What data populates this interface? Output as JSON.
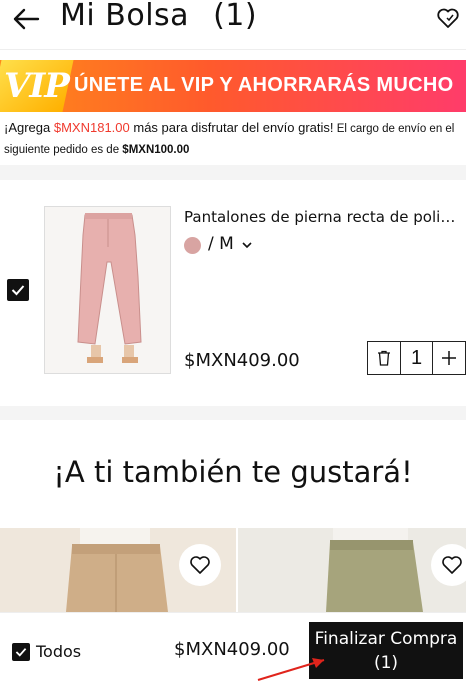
{
  "header": {
    "title": "Mi Bolsa",
    "count": "(1)",
    "back_icon": "arrow-left-icon",
    "wishlist_icon": "heart-icon"
  },
  "vip_banner": {
    "logo": "VIP",
    "message": "ÚNETE AL VIP Y AHORRARÁS MUCHO",
    "colors": {
      "start": "#ff8a1a",
      "end": "#ff3c6a",
      "badge": "#ffcc22"
    }
  },
  "shipping": {
    "prefix": "¡Agrega ",
    "amount": "$MXN181.00",
    "middle": " más para disfrutar del envío gratis!",
    "note_prefix": " El cargo de envío en el siguiente pedido es de ",
    "note_amount": "$MXN100.00"
  },
  "cart": {
    "items": [
      {
        "name": "Pantalones de pierna recta de poliést...",
        "color_swatch": "#d8a4a2",
        "variant": "/ M",
        "price": "$MXN409.00",
        "quantity": "1",
        "checked": true
      }
    ]
  },
  "recommendations": {
    "title": "¡A ti también te gustará!"
  },
  "footer": {
    "select_all_label": "Todos",
    "total": "$MXN409.00",
    "checkout_label": "Finalizar Compra",
    "checkout_count": "(1)"
  },
  "colors": {
    "accent_red": "#f03a2e",
    "black": "#111111"
  }
}
